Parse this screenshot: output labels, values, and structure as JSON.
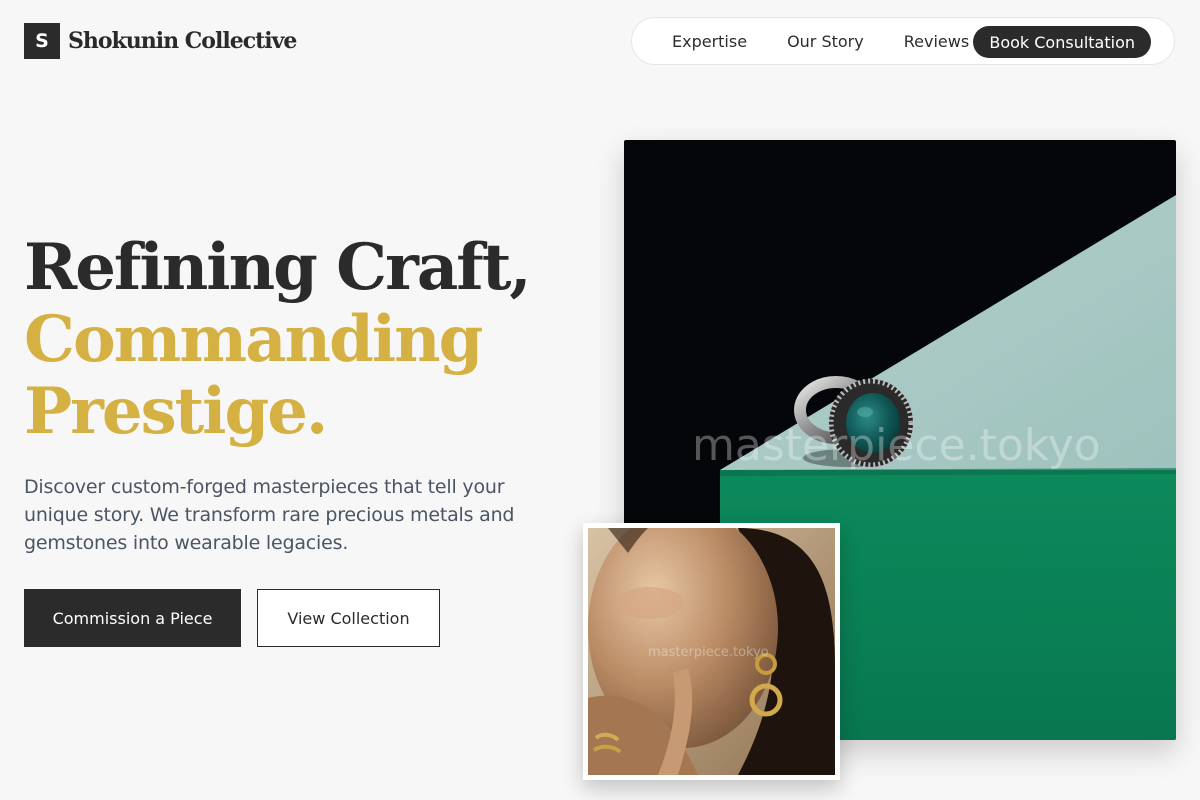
{
  "header": {
    "brand_mark": "S",
    "brand_name": "Shokunin Collective",
    "nav": {
      "links": [
        "Expertise",
        "Our Story",
        "Reviews"
      ],
      "cta": "Book Consultation"
    }
  },
  "hero": {
    "headline_line1": "Refining Craft,",
    "headline_accent_1": "Commanding",
    "headline_accent_2": "Prestige.",
    "lede": "Discover custom-forged masterpieces that tell your unique story. We transform rare precious metals and gemstones into wearable legacies.",
    "primary_button": "Commission a Piece",
    "secondary_button": "View Collection"
  },
  "images": {
    "main_watermark": "masterpiece.tokyo",
    "portrait_watermark": "masterpiece.tokyo"
  },
  "colors": {
    "accent_gold": "#d5b043",
    "dark": "#2b2b2b",
    "emerald": "#0a7a52",
    "background": "#f7f7f7"
  }
}
